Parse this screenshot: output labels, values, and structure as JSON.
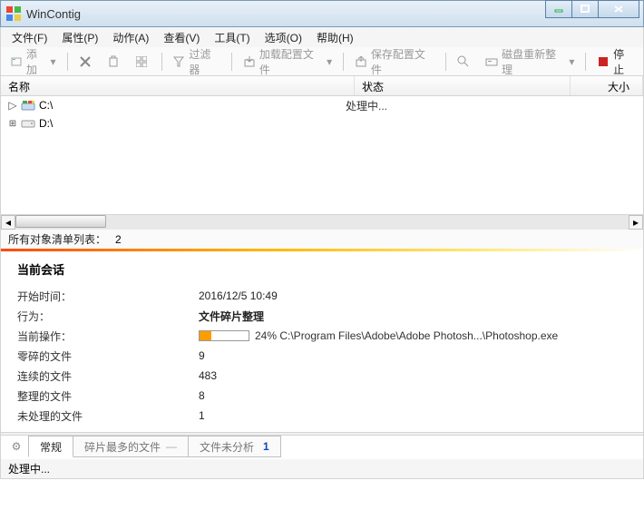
{
  "title": "WinContig",
  "menus": [
    "文件(F)",
    "属性(P)",
    "动作(A)",
    "查看(V)",
    "工具(T)",
    "选项(O)",
    "帮助(H)"
  ],
  "toolbar": {
    "add": "添加",
    "filter": "过滤器",
    "load_profile": "加载配置文件",
    "save_profile": "保存配置文件",
    "defrag_disk": "磁盘重新整理",
    "stop": "停止"
  },
  "columns": {
    "name": "名称",
    "status": "状态",
    "size": "大小"
  },
  "rows": [
    {
      "expander": "▷",
      "icon": "drive-c",
      "label": "C:\\",
      "status": "处理中..."
    },
    {
      "expander": "▷",
      "icon": "drive-d",
      "label": "D:\\",
      "status": ""
    }
  ],
  "objects_list": {
    "label": "所有对象清单列表：",
    "value": "2"
  },
  "session": {
    "heading": "当前会话",
    "start_label": "开始时间：",
    "start_value": "2016/12/5 10:49",
    "action_label": "行为：",
    "action_value": "文件碎片整理",
    "current_label": "当前操作：",
    "progress_pct": 24,
    "progress_text": "24% C:\\Program Files\\Adobe\\Adobe Photosh...\\Photoshop.exe",
    "frag_label": "零碎的文件",
    "frag_value": "9",
    "contig_label": "连续的文件",
    "contig_value": "483",
    "defrag_label": "整理的文件",
    "defrag_value": "8",
    "pending_label": "未处理的文件",
    "pending_value": "1"
  },
  "tabs": {
    "general": "常规",
    "mostfrag": "碎片最多的文件",
    "unanalyzed": "文件未分析",
    "unanalyzed_count": "1"
  },
  "statusbar": "处理中..."
}
